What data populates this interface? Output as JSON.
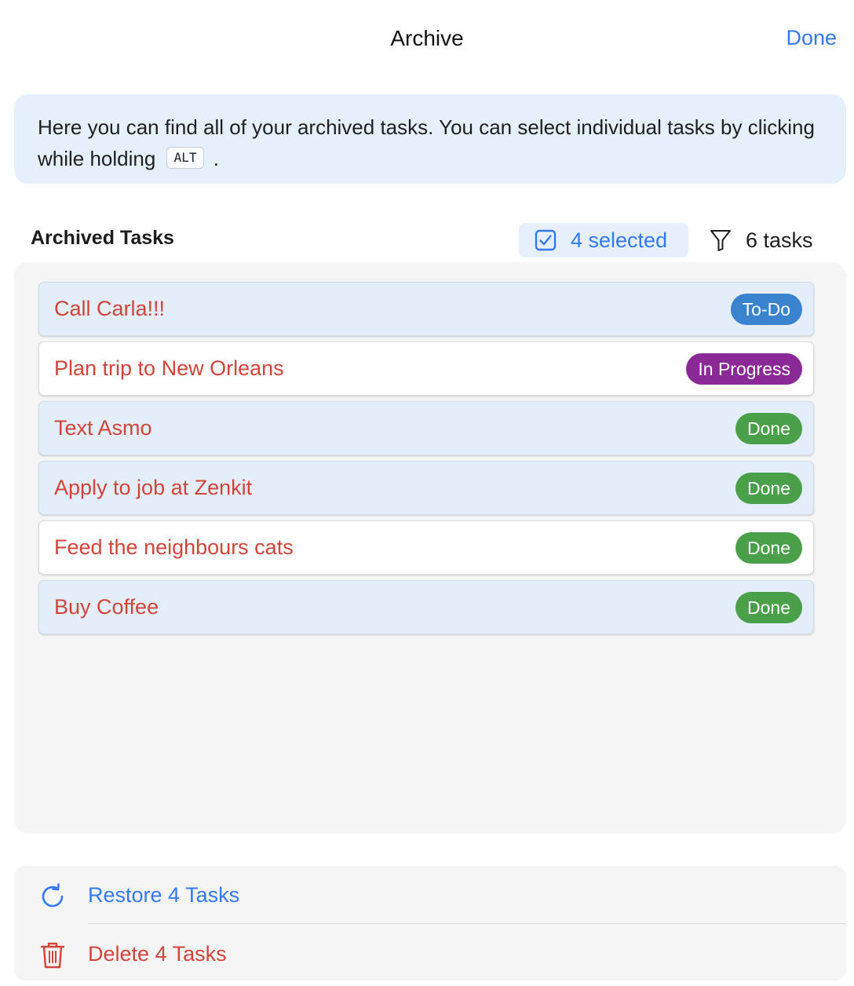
{
  "header": {
    "title": "Archive",
    "done_label": "Done"
  },
  "info": {
    "text_before": "Here you can find all of your archived tasks. You can select individual tasks by clicking while holding",
    "key": "ALT",
    "text_after": "."
  },
  "section": {
    "title": "Archived Tasks",
    "selected_label": "4 selected",
    "count_label": "6 tasks"
  },
  "tasks": [
    {
      "title": "Call Carla!!!",
      "status": "To-Do",
      "status_color": "#3a83cf",
      "selected": true
    },
    {
      "title": "Plan trip to New Orleans",
      "status": "In Progress",
      "status_color": "#8b2a96",
      "selected": false
    },
    {
      "title": "Text Asmo",
      "status": "Done",
      "status_color": "#4aa049",
      "selected": true
    },
    {
      "title": "Apply to job at Zenkit",
      "status": "Done",
      "status_color": "#4aa049",
      "selected": true
    },
    {
      "title": "Feed the neighbours cats",
      "status": "Done",
      "status_color": "#4aa049",
      "selected": false
    },
    {
      "title": "Buy Coffee",
      "status": "Done",
      "status_color": "#4aa049",
      "selected": true
    }
  ],
  "actions": {
    "restore_label": "Restore 4 Tasks",
    "restore_icon": "refresh-icon",
    "delete_label": "Delete 4 Tasks",
    "delete_icon": "trash-icon"
  },
  "colors": {
    "accent": "#3478f6",
    "danger": "#d2443a"
  }
}
